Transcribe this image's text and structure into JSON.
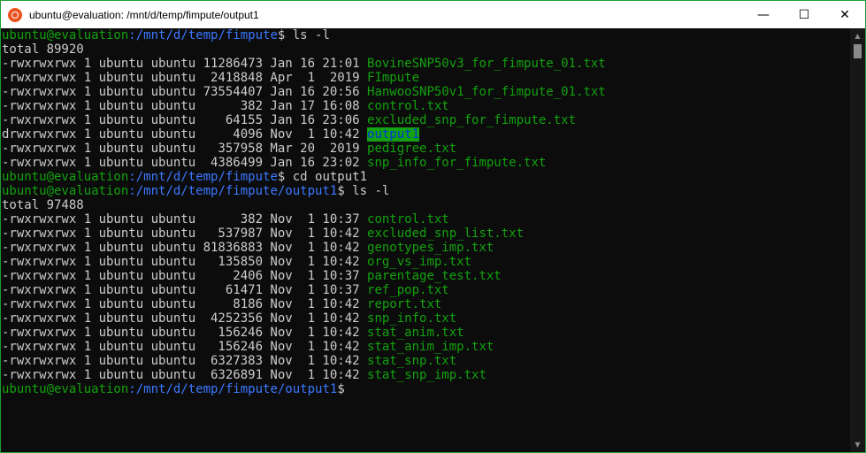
{
  "window": {
    "title": "ubuntu@evaluation: /mnt/d/temp/fimpute/output1",
    "app_icon": "ubuntu-logo-icon",
    "controls": {
      "minimize": "—",
      "maximize": "☐",
      "close": "✕"
    },
    "colors": {
      "prompt_user": "#13a10e",
      "prompt_path": "#3b78ff",
      "text": "#cccccc",
      "background": "#0c0c0c",
      "file_green": "#13a10e",
      "dir_highlight_bg": "#13a10e",
      "dir_highlight_fg": "#0037da"
    }
  },
  "terminal": {
    "lines": [
      {
        "type": "prompt",
        "user": "ubuntu@evaluation",
        "path": ":/mnt/d/temp/fimpute",
        "cmd": "$ ls -l"
      },
      {
        "type": "text",
        "text": "total 89920"
      },
      {
        "type": "file",
        "meta": "-rwxrwxrwx 1 ubuntu ubuntu 11286473 Jan 16 21:01 ",
        "name": "BovineSNP50v3_for_fimpute_01.txt"
      },
      {
        "type": "file",
        "meta": "-rwxrwxrwx 1 ubuntu ubuntu  2418848 Apr  1  2019 ",
        "name": "FImpute"
      },
      {
        "type": "file",
        "meta": "-rwxrwxrwx 1 ubuntu ubuntu 73554407 Jan 16 20:56 ",
        "name": "HanwooSNP50v1_for_fimpute_01.txt"
      },
      {
        "type": "file",
        "meta": "-rwxrwxrwx 1 ubuntu ubuntu      382 Jan 17 16:08 ",
        "name": "control.txt"
      },
      {
        "type": "file",
        "meta": "-rwxrwxrwx 1 ubuntu ubuntu    64155 Jan 16 23:06 ",
        "name": "excluded_snp_for_fimpute.txt"
      },
      {
        "type": "dir",
        "meta": "drwxrwxrwx 1 ubuntu ubuntu     4096 Nov  1 10:42 ",
        "name": "output1"
      },
      {
        "type": "file",
        "meta": "-rwxrwxrwx 1 ubuntu ubuntu   357958 Mar 20  2019 ",
        "name": "pedigree.txt"
      },
      {
        "type": "file",
        "meta": "-rwxrwxrwx 1 ubuntu ubuntu  4386499 Jan 16 23:02 ",
        "name": "snp_info_for_fimpute.txt"
      },
      {
        "type": "prompt",
        "user": "ubuntu@evaluation",
        "path": ":/mnt/d/temp/fimpute",
        "cmd": "$ cd output1"
      },
      {
        "type": "prompt",
        "user": "ubuntu@evaluation",
        "path": ":/mnt/d/temp/fimpute/output1",
        "cmd": "$ ls -l"
      },
      {
        "type": "text",
        "text": "total 97488"
      },
      {
        "type": "file",
        "meta": "-rwxrwxrwx 1 ubuntu ubuntu      382 Nov  1 10:37 ",
        "name": "control.txt"
      },
      {
        "type": "file",
        "meta": "-rwxrwxrwx 1 ubuntu ubuntu   537987 Nov  1 10:42 ",
        "name": "excluded_snp_list.txt"
      },
      {
        "type": "file",
        "meta": "-rwxrwxrwx 1 ubuntu ubuntu 81836883 Nov  1 10:42 ",
        "name": "genotypes_imp.txt"
      },
      {
        "type": "file",
        "meta": "-rwxrwxrwx 1 ubuntu ubuntu   135850 Nov  1 10:42 ",
        "name": "org_vs_imp.txt"
      },
      {
        "type": "file",
        "meta": "-rwxrwxrwx 1 ubuntu ubuntu     2406 Nov  1 10:37 ",
        "name": "parentage_test.txt"
      },
      {
        "type": "file",
        "meta": "-rwxrwxrwx 1 ubuntu ubuntu    61471 Nov  1 10:37 ",
        "name": "ref_pop.txt"
      },
      {
        "type": "file",
        "meta": "-rwxrwxrwx 1 ubuntu ubuntu     8186 Nov  1 10:42 ",
        "name": "report.txt"
      },
      {
        "type": "file",
        "meta": "-rwxrwxrwx 1 ubuntu ubuntu  4252356 Nov  1 10:42 ",
        "name": "snp_info.txt"
      },
      {
        "type": "file",
        "meta": "-rwxrwxrwx 1 ubuntu ubuntu   156246 Nov  1 10:42 ",
        "name": "stat_anim.txt"
      },
      {
        "type": "file",
        "meta": "-rwxrwxrwx 1 ubuntu ubuntu   156246 Nov  1 10:42 ",
        "name": "stat_anim_imp.txt"
      },
      {
        "type": "file",
        "meta": "-rwxrwxrwx 1 ubuntu ubuntu  6327383 Nov  1 10:42 ",
        "name": "stat_snp.txt"
      },
      {
        "type": "file",
        "meta": "-rwxrwxrwx 1 ubuntu ubuntu  6326891 Nov  1 10:42 ",
        "name": "stat_snp_imp.txt"
      },
      {
        "type": "prompt",
        "user": "ubuntu@evaluation",
        "path": ":/mnt/d/temp/fimpute/output1",
        "cmd": "$"
      }
    ]
  },
  "scrollbar": {
    "up": "▲",
    "down": "▼"
  }
}
